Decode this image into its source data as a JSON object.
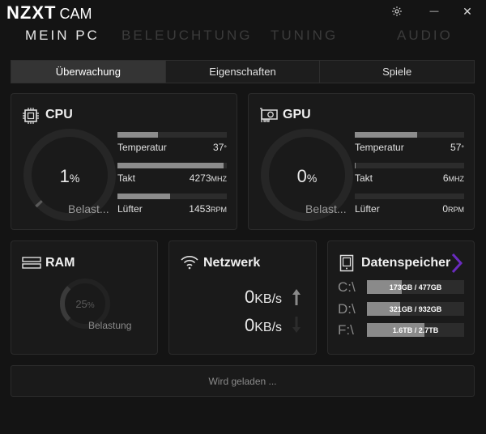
{
  "app": {
    "logo_main": "NZXT",
    "logo_sub": "CAM"
  },
  "window": {
    "settings_icon": "gear-icon",
    "minimize_glyph": "—",
    "close_glyph": "✕"
  },
  "nav": {
    "items": [
      {
        "label": "MEIN PC",
        "active": true
      },
      {
        "label": "BELEUCHTUNG",
        "active": false
      },
      {
        "label": "TUNING",
        "active": false
      },
      {
        "label": "AUDIO",
        "active": false
      }
    ]
  },
  "tabs": [
    {
      "label": "Überwachung",
      "active": true
    },
    {
      "label": "Eigenschaften",
      "active": false
    },
    {
      "label": "Spiele",
      "active": false
    }
  ],
  "cpu": {
    "title": "CPU",
    "load_value": "1",
    "load_unit": "%",
    "load_fraction": 0.01,
    "load_label": "Belast...",
    "metrics": [
      {
        "label": "Temperatur",
        "value": "37",
        "unit": "°",
        "fill": 0.37
      },
      {
        "label": "Takt",
        "value": "4273",
        "unit": "MHZ",
        "fill": 0.97
      },
      {
        "label": "Lüfter",
        "value": "1453",
        "unit": "RPM",
        "fill": 0.48
      }
    ]
  },
  "gpu": {
    "title": "GPU",
    "load_value": "0",
    "load_unit": "%",
    "load_fraction": 0.0,
    "load_label": "Belast...",
    "metrics": [
      {
        "label": "Temperatur",
        "value": "57",
        "unit": "°",
        "fill": 0.57
      },
      {
        "label": "Takt",
        "value": "6",
        "unit": "MHZ",
        "fill": 0.01
      },
      {
        "label": "Lüfter",
        "value": "0",
        "unit": "RPM",
        "fill": 0.0
      }
    ]
  },
  "ram": {
    "title": "RAM",
    "load_value": "25",
    "load_unit": "%",
    "load_fraction": 0.25,
    "load_label": "Belastung"
  },
  "network": {
    "title": "Netzwerk",
    "up_value": "0",
    "up_unit": "KB/s",
    "down_value": "0",
    "down_unit": "KB/s"
  },
  "storage": {
    "title": "Datenspeicher",
    "drives": [
      {
        "letter": "C:\\",
        "usage": "173GB / 477GB",
        "fill": 0.36
      },
      {
        "letter": "D:\\",
        "usage": "321GB / 932GB",
        "fill": 0.34
      },
      {
        "letter": "F:\\",
        "usage": "1.6TB / 2.7TB",
        "fill": 0.59
      }
    ]
  },
  "footer": {
    "loading_text": "Wird geladen ..."
  },
  "colors": {
    "accent_purple": "#6a2bbf",
    "bar_fill": "#8c8c8c",
    "gauge_track": "#262626",
    "gauge_arc": "#5a5a5a"
  }
}
